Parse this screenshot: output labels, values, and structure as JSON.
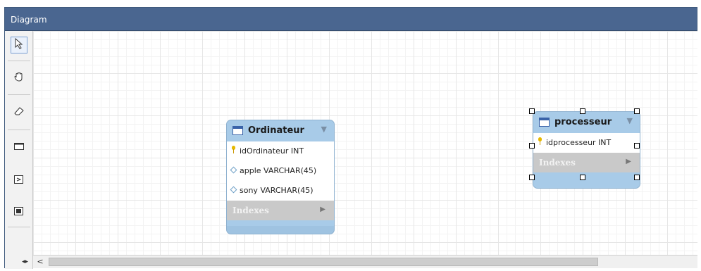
{
  "window": {
    "title": "Diagram"
  },
  "toolbar": {
    "tools": [
      {
        "icon": "pointer-icon"
      },
      {
        "icon": "hand-icon"
      },
      {
        "icon": "eraser-icon"
      },
      {
        "icon": "layer-icon"
      },
      {
        "icon": "text-icon"
      },
      {
        "icon": "image-icon"
      }
    ]
  },
  "tables": [
    {
      "name": "Ordinateur",
      "columns": [
        {
          "text": "idOrdinateur INT",
          "kind": "primary-key"
        },
        {
          "text": "apple VARCHAR(45)",
          "kind": "column"
        },
        {
          "text": "sony VARCHAR(45)",
          "kind": "column"
        }
      ],
      "indexes_label": "Indexes",
      "selected": false
    },
    {
      "name": "processeur",
      "columns": [
        {
          "text": "idprocesseur INT",
          "kind": "primary-key"
        }
      ],
      "indexes_label": "Indexes",
      "selected": true
    }
  ],
  "scrollbar": {
    "left_arrow": "<"
  },
  "colors": {
    "titlebar": "#4a6690",
    "table_header": "#a8cbe8",
    "indexes_bar": "#c9c9c9"
  }
}
